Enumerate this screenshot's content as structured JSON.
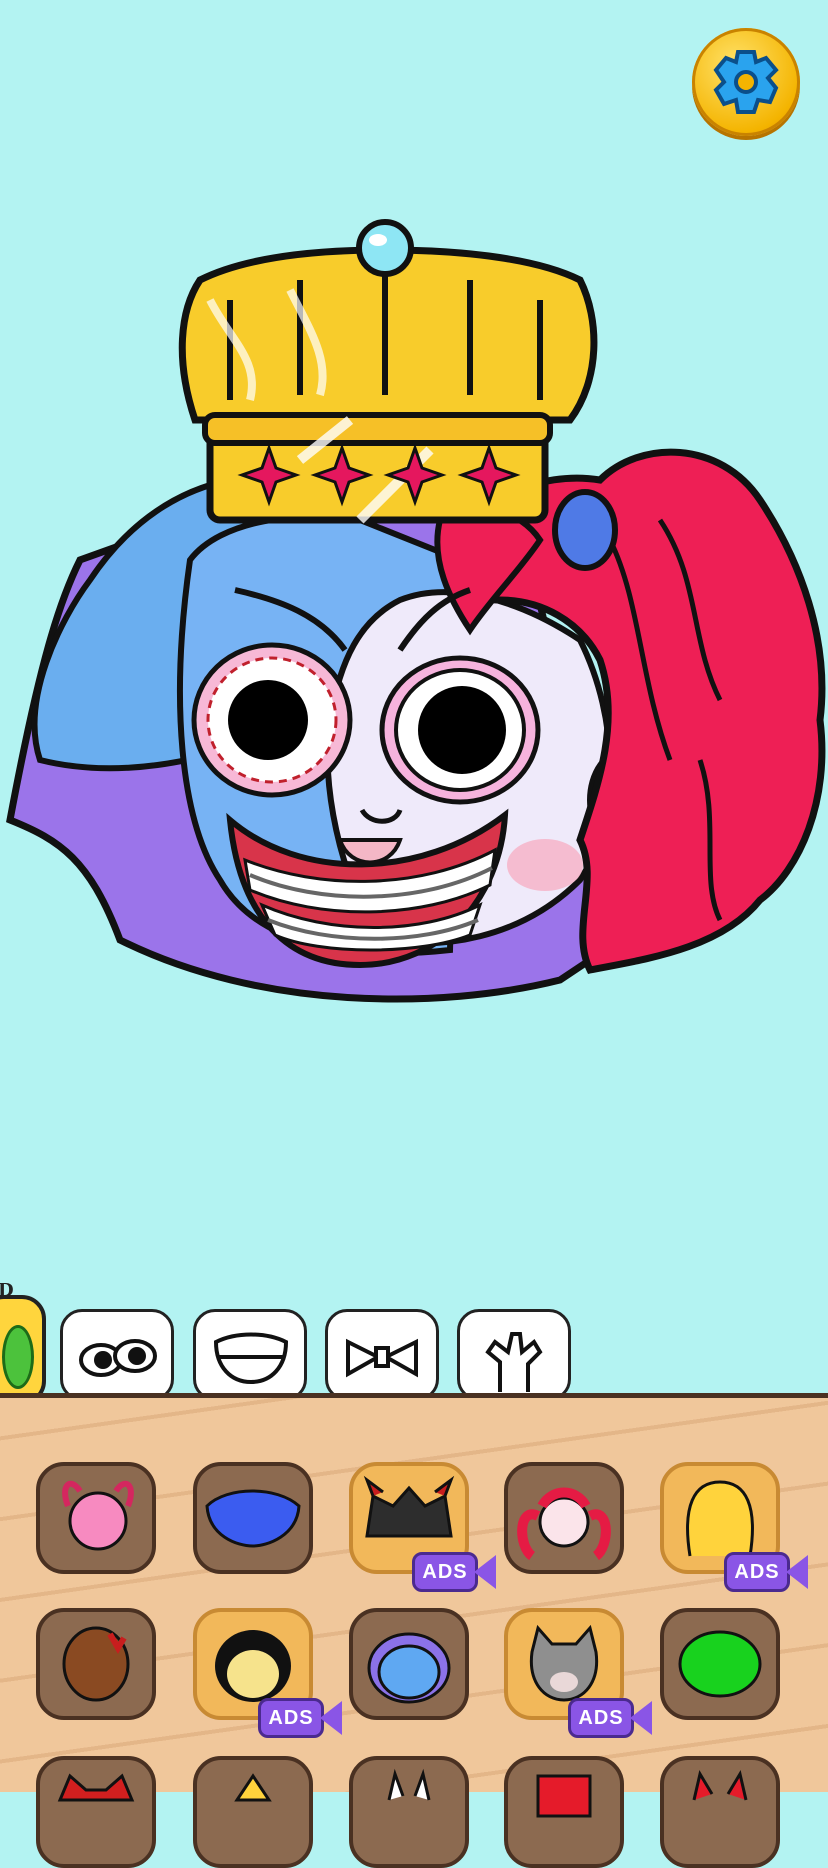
{
  "header": {
    "settings_icon": "gear-icon"
  },
  "character": {
    "accessory": "crown",
    "hair": "red-ponytail",
    "mouth": "braces-grin"
  },
  "category_tabs": {
    "cut_label": "D",
    "tabs": [
      {
        "name": "tab-face",
        "icon": "leaf-icon",
        "selected": true
      },
      {
        "name": "tab-eyes",
        "icon": "eyes-icon"
      },
      {
        "name": "tab-mouth",
        "icon": "mouth-icon"
      },
      {
        "name": "tab-accessory",
        "icon": "bow-icon"
      },
      {
        "name": "tab-hands",
        "icon": "hand-icon"
      }
    ]
  },
  "items": {
    "ads_label": "ADS",
    "row1": [
      "pink-pigtails-hair",
      "blue-hair",
      "dark-horned-hair",
      "red-pigtail-head",
      "yellow-bunny-hair"
    ],
    "row2": [
      "brown-bloody-head",
      "ink-demon-head",
      "blue-furry-head",
      "gray-cat-head",
      "green-head"
    ],
    "locked": [
      "dark-horned-hair",
      "yellow-bunny-hair",
      "ink-demon-head",
      "gray-cat-head"
    ]
  },
  "colors": {
    "background": "#b3f3f2",
    "panel": "#f0c79b",
    "ads": "#8a55e6",
    "tab_active": "#ffd53d"
  }
}
